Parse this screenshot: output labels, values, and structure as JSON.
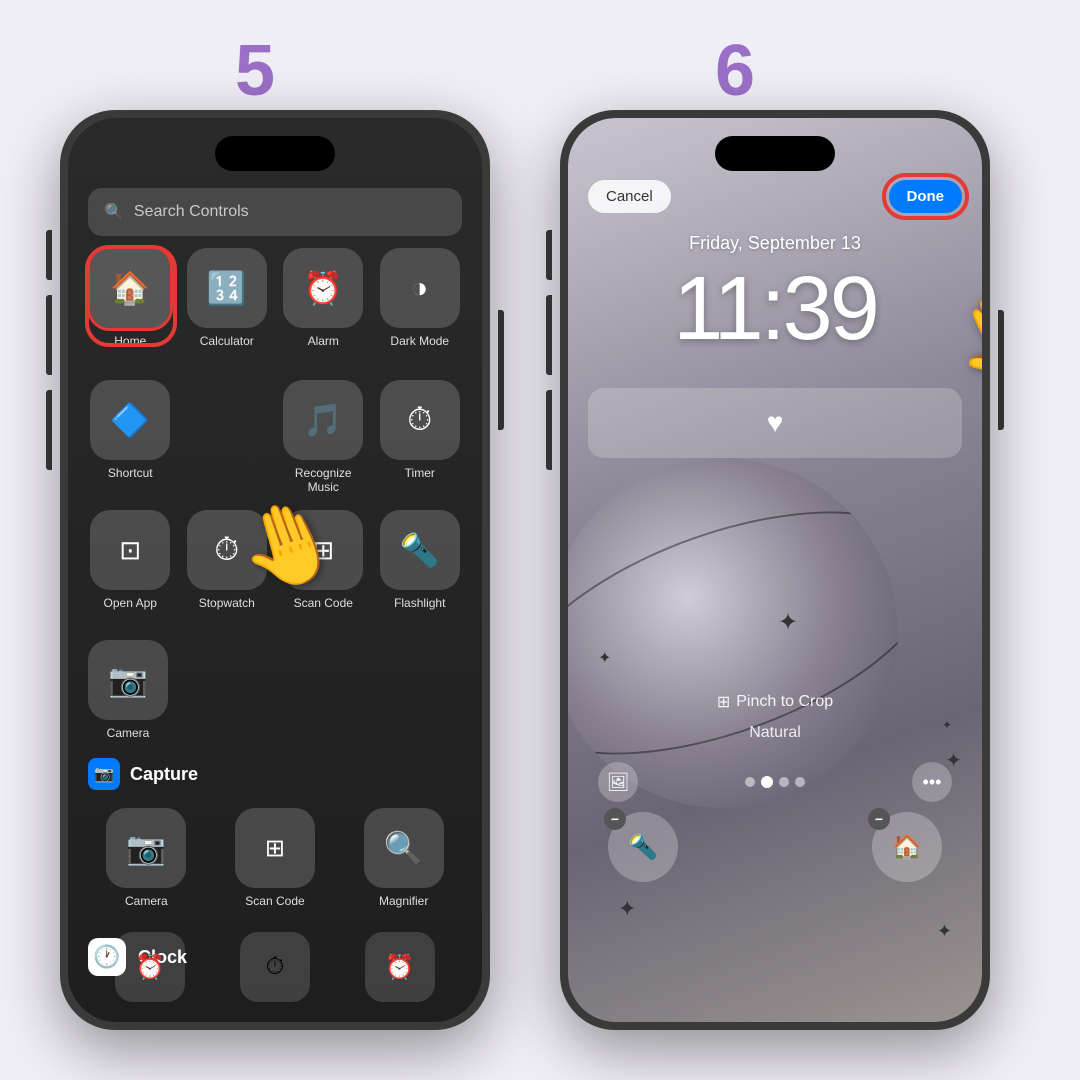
{
  "step_left": "5",
  "step_right": "6",
  "left_phone": {
    "search_placeholder": "Search Controls",
    "controls_row1": [
      {
        "label": "Home",
        "icon": "🏠",
        "selected": true
      },
      {
        "label": "Calculator",
        "icon": "🔢"
      },
      {
        "label": "Alarm",
        "icon": "⏰"
      },
      {
        "label": "Dark Mode",
        "icon": "◑"
      }
    ],
    "controls_row2": [
      {
        "label": "Shortcut",
        "icon": "🔷"
      },
      {
        "label": "Recognize Music",
        "icon": "🎵"
      },
      {
        "label": "Timer",
        "icon": "⏱"
      }
    ],
    "controls_row3": [
      {
        "label": "Open App",
        "icon": "⊡"
      },
      {
        "label": "Stopwatch",
        "icon": "⏱"
      },
      {
        "label": "Scan Code",
        "icon": "⊞"
      },
      {
        "label": "Flashlight",
        "icon": "🔦"
      }
    ],
    "controls_row4": [
      {
        "label": "Camera",
        "icon": "📷"
      }
    ],
    "capture_section_label": "Capture",
    "capture_items": [
      {
        "label": "Camera",
        "icon": "📷"
      },
      {
        "label": "Scan Code",
        "icon": "⊞"
      },
      {
        "label": "Magnifier",
        "icon": "🔍"
      }
    ],
    "clock_section_label": "Clock"
  },
  "right_phone": {
    "cancel_label": "Cancel",
    "done_label": "Done",
    "date": "Friday, September 13",
    "time": "11:39",
    "pinch_to_crop": "Pinch to Crop",
    "natural_label": "Natural"
  }
}
